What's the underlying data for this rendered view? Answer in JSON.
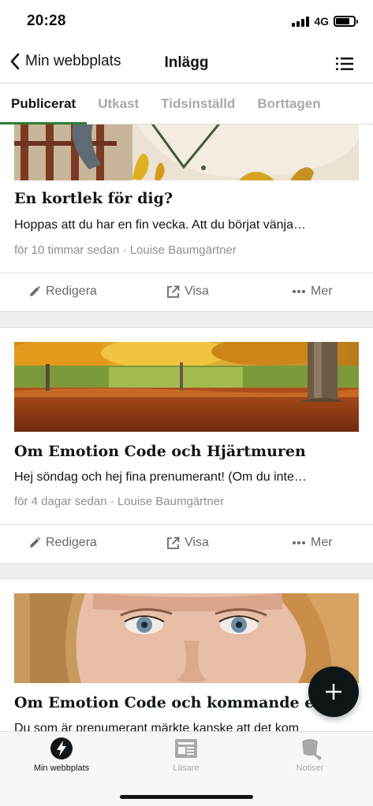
{
  "status_bar": {
    "time": "20:28",
    "network": "4G"
  },
  "nav": {
    "back_label": "Min webbplats",
    "title": "Inlägg"
  },
  "tabs": [
    {
      "label": "Publicerat",
      "active": true
    },
    {
      "label": "Utkast",
      "active": false
    },
    {
      "label": "Tidsinställd",
      "active": false
    },
    {
      "label": "Borttagen",
      "active": false
    }
  ],
  "posts": [
    {
      "title": "En kortlek för dig?",
      "excerpt": "Hoppas att du har en fin vecka. Att du börjat vänja…",
      "meta": "för 10 timmar sedan · Louise Baumgärtner"
    },
    {
      "title": "Om Emotion Code och Hjärtmuren",
      "excerpt": "Hej söndag och hej fina prenumerant! (Om du inte…",
      "meta": "för 4 dagar sedan · Louise Baumgärtner"
    },
    {
      "title": "Om Emotion Code och kommande erbj",
      "excerpt": "Du som är prenumerant märkte kanske att det kom"
    }
  ],
  "actions": {
    "edit_label": "Redigera",
    "view_label": "Visa",
    "more_label": "Mer"
  },
  "tabbar": [
    {
      "label": "Min webbplats",
      "icon": "wordpress-icon",
      "active": true
    },
    {
      "label": "Läsare",
      "icon": "reader-icon",
      "active": false
    },
    {
      "label": "Notiser",
      "icon": "bell-icon",
      "active": false
    }
  ]
}
